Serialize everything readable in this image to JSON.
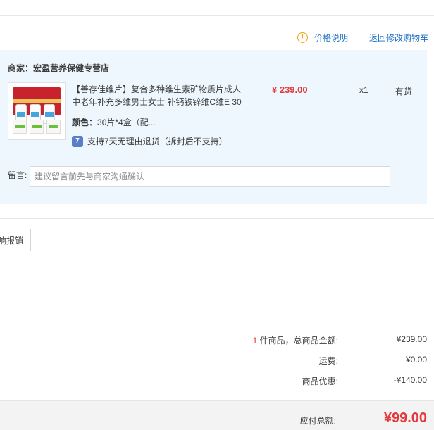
{
  "header": {
    "price_note": "价格说明",
    "back_to_cart": "返回修改购物车"
  },
  "shop": {
    "label": "商家：宏盈营养保健专营店"
  },
  "item": {
    "title": "【善存佳维片】复合多种维生素矿物质片成人中老年补充多维男士女士 补钙铁锌维C维E 30",
    "color_label": "颜色：",
    "color_value": "30片*4盒（配...",
    "service": "支持7天无理由退货（拆封后不支持）",
    "service_icon_glyph": "7",
    "price": "¥ 239.00",
    "quantity": "x1",
    "stock": "有货"
  },
  "message": {
    "label": "留言:",
    "placeholder": "建议留言前先与商家沟通确认",
    "value": ""
  },
  "expense_button": "响报销",
  "summary": {
    "count": "1",
    "items_label": " 件商品，总商品金额:",
    "items_value": "¥239.00",
    "shipping_label": "运费:",
    "shipping_value": "¥0.00",
    "discount_label": "商品优惠:",
    "discount_value": "-¥140.00"
  },
  "total": {
    "label": "应付总额:",
    "value": "¥99.00"
  },
  "icons": {
    "info": "info-circle-icon",
    "service": "return-service-icon"
  },
  "colors": {
    "price_red": "#e4393c",
    "link_blue": "#1e6fc6",
    "panel_bg": "#eef7fd",
    "warning_orange": "#f0a30a"
  }
}
